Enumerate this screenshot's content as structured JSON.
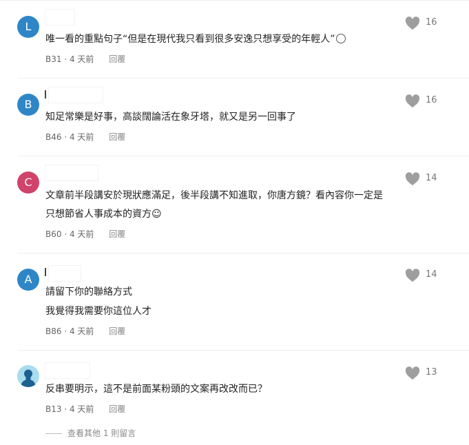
{
  "colors": {
    "avatar_L": "#2f86c6",
    "avatar_B": "#2f86c6",
    "avatar_C": "#d0436a",
    "avatar_A": "#2f86c6",
    "avatar_photo": "#a9dcee",
    "like_icon": "#9e9e9e"
  },
  "icons": {
    "like": "heart-icon",
    "reaction": "emoji-face-icon"
  },
  "comments": [
    {
      "avatar_letter": "L",
      "lines": [
        "唯一看的重點句子“但是在現代我只看到很多安逸只想享受的年輕人”"
      ],
      "floor": "B31",
      "time": "4 天前",
      "reply": "回覆",
      "likes": "16"
    },
    {
      "avatar_letter": "B",
      "lines": [
        "知足常樂是好事，高談闊論活在象牙塔，就又是另一回事了"
      ],
      "floor": "B46",
      "time": "4 天前",
      "reply": "回覆",
      "likes": "16"
    },
    {
      "avatar_letter": "C",
      "lines": [
        "文章前半段講安於現狀應滿足，後半段講不知進取，你唐方鏡？看內容你一定是",
        "只想節省人事成本的資方☺"
      ],
      "floor": "B60",
      "time": "4 天前",
      "reply": "回覆",
      "likes": "14"
    },
    {
      "avatar_letter": "A",
      "lines": [
        "請留下你的聯絡方式",
        "我覺得我需要你這位人才"
      ],
      "floor": "B86",
      "time": "4 天前",
      "reply": "回覆",
      "likes": "14"
    },
    {
      "avatar_letter": "",
      "lines": [
        "反串要明示，這不是前面某粉頭的文案再改改而已？"
      ],
      "floor": "B13",
      "time": "4 天前",
      "reply": "回覆",
      "likes": "13"
    }
  ],
  "more_replies": "查看其他 1 則留言"
}
